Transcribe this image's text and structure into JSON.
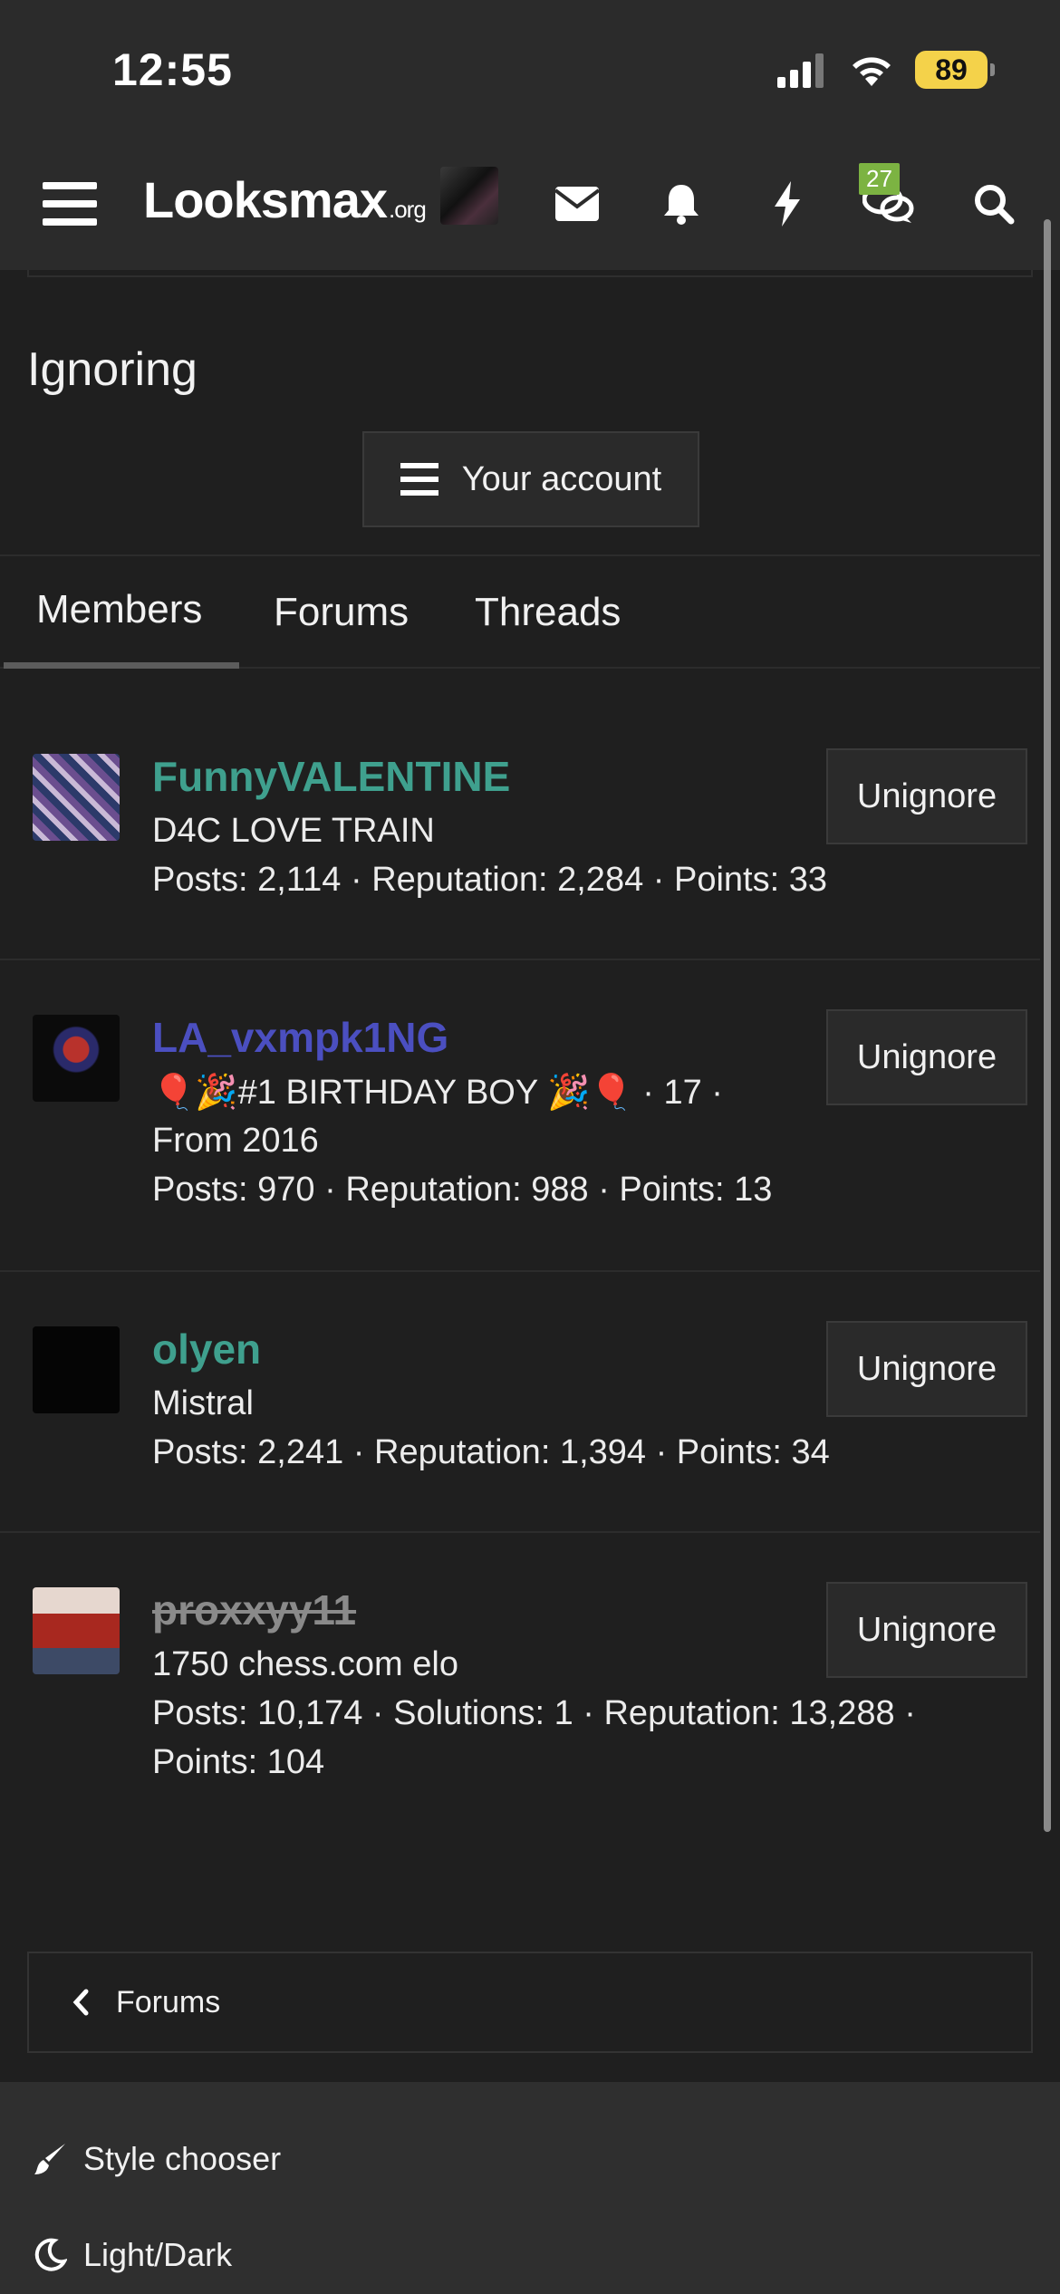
{
  "status_bar": {
    "time": "12:55",
    "battery": "89"
  },
  "nav": {
    "logo_main": "Looksmax",
    "logo_suffix": ".org",
    "chat_badge": "27"
  },
  "page": {
    "title": "Ignoring",
    "account_button": "Your account"
  },
  "tabs": [
    {
      "label": "Members"
    },
    {
      "label": "Forums"
    },
    {
      "label": "Threads"
    }
  ],
  "members": [
    {
      "name": "FunnyVALENTINE",
      "name_color": "#3fa08e",
      "line1": "D4C LOVE TRAIN",
      "line2": "Posts: 2,114 · Reputation: 2,284 · Points: 33",
      "button": "Unignore"
    },
    {
      "name": "LA_vxmpk1NG",
      "name_color": "#4b4fc0",
      "line1": "🎈🎉#1 BIRTHDAY BOY 🎉🎈 · 17 ·",
      "line2": "From 2016",
      "line3": "Posts: 970 · Reputation: 988 · Points: 13",
      "button": "Unignore"
    },
    {
      "name": "olyen",
      "name_color": "#3fa08e",
      "line1": "Mistral",
      "line2": "Posts: 2,241 · Reputation: 1,394 · Points: 34",
      "button": "Unignore"
    },
    {
      "name": "proxxyy11",
      "name_color": "#8a8a8a",
      "line1": "1750 chess.com elo",
      "line2": "Posts: 10,174 · Solutions: 1 · Reputation: 13,288 ·",
      "line3": "Points: 104",
      "button": "Unignore"
    }
  ],
  "bottom": {
    "forums_link": "Forums",
    "style_chooser": "Style chooser",
    "light_dark": "Light/Dark"
  },
  "icons": [
    "menu-icon",
    "envelope-icon",
    "bell-icon",
    "bolt-icon",
    "chat-icon",
    "search-icon",
    "chevron-left-icon",
    "brush-icon",
    "moon-icon"
  ]
}
